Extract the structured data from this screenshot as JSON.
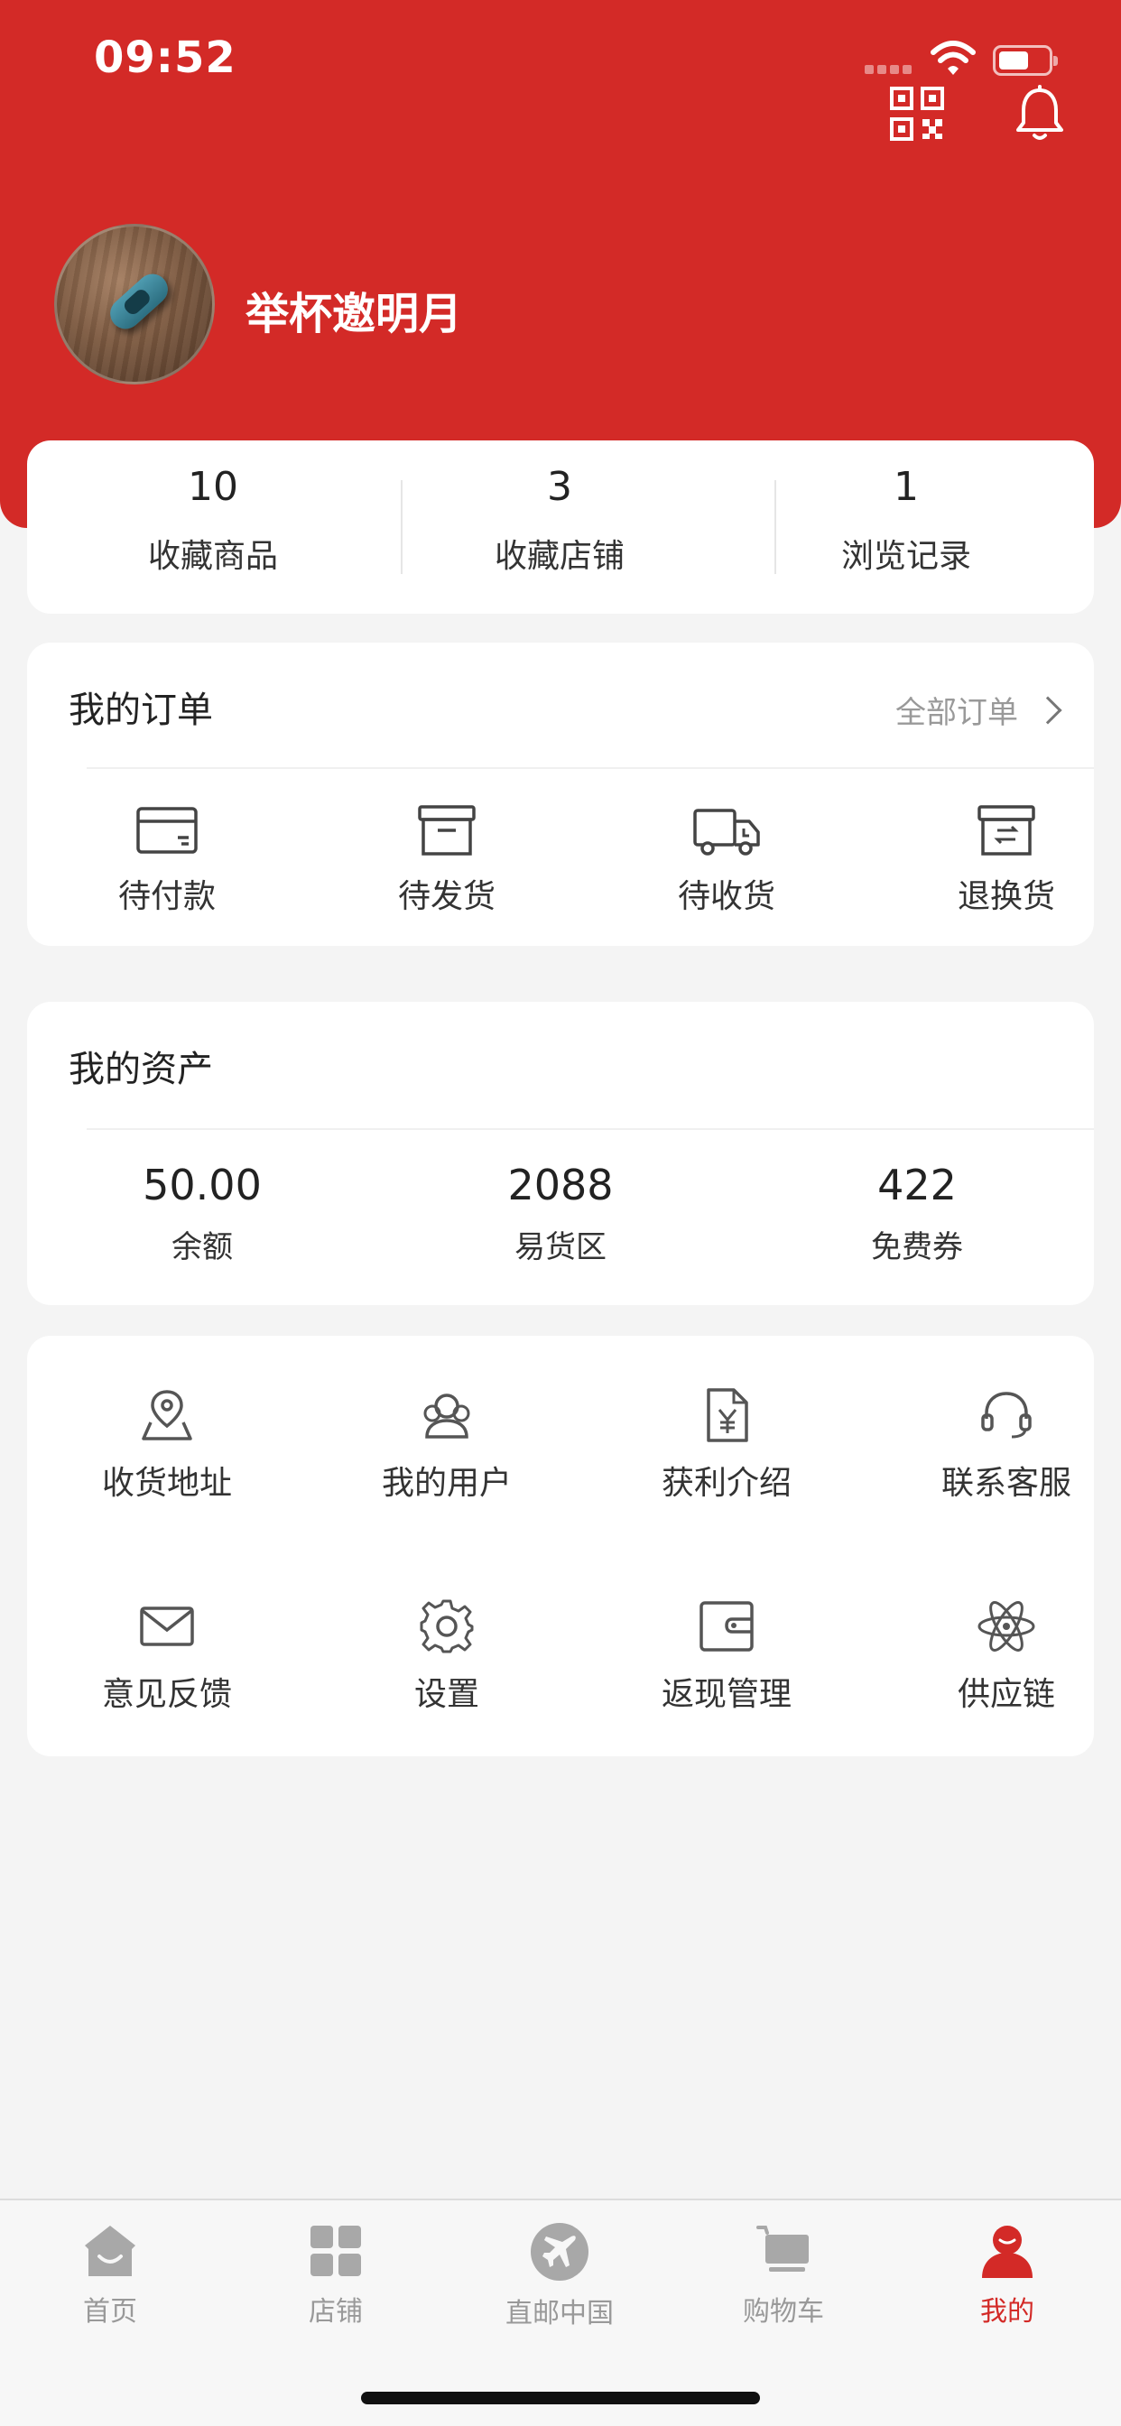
{
  "status_bar": {
    "time": "09:52"
  },
  "profile": {
    "username": "举杯邀明月"
  },
  "stats": [
    {
      "value": "10",
      "label": "收藏商品"
    },
    {
      "value": "3",
      "label": "收藏店铺"
    },
    {
      "value": "1",
      "label": "浏览记录"
    }
  ],
  "orders": {
    "title": "我的订单",
    "all_label": "全部订单",
    "items": [
      {
        "label": "待付款",
        "icon": "card-icon"
      },
      {
        "label": "待发货",
        "icon": "box-icon"
      },
      {
        "label": "待收货",
        "icon": "truck-icon"
      },
      {
        "label": "退换货",
        "icon": "exchange-box-icon"
      }
    ]
  },
  "assets": {
    "title": "我的资产",
    "items": [
      {
        "value": "50.00",
        "label": "余额"
      },
      {
        "value": "2088",
        "label": "易货区"
      },
      {
        "value": "422",
        "label": "免费券"
      }
    ]
  },
  "tools": [
    {
      "label": "收货地址",
      "icon": "location-map-icon"
    },
    {
      "label": "我的用户",
      "icon": "users-icon"
    },
    {
      "label": "获利介绍",
      "icon": "yuan-document-icon"
    },
    {
      "label": "联系客服",
      "icon": "headset-icon"
    },
    {
      "label": "意见反馈",
      "icon": "mail-icon"
    },
    {
      "label": "设置",
      "icon": "gear-icon"
    },
    {
      "label": "返现管理",
      "icon": "wallet-icon"
    },
    {
      "label": "供应链",
      "icon": "atom-icon"
    }
  ],
  "tabbar": [
    {
      "label": "首页",
      "icon": "home-icon"
    },
    {
      "label": "店铺",
      "icon": "grid-icon"
    },
    {
      "label": "直邮中国",
      "icon": "airplane-icon"
    },
    {
      "label": "购物车",
      "icon": "cart-icon"
    },
    {
      "label": "我的",
      "icon": "user-icon",
      "active": true
    }
  ],
  "colors": {
    "brand_red": "#d32a27",
    "background": "#f4f4f4",
    "inactive_tab": "#999999"
  }
}
